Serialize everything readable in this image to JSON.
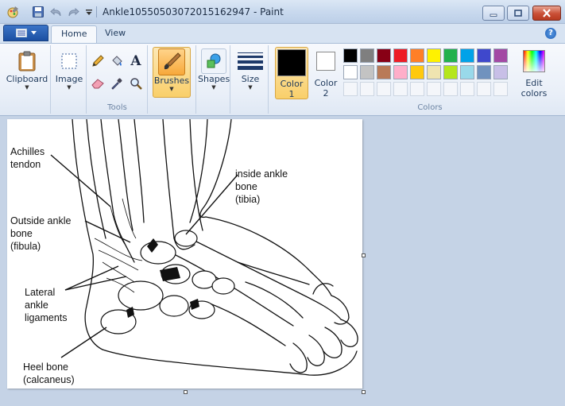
{
  "window": {
    "title": "Ankle10550503072015162947 - Paint"
  },
  "quick_access": {
    "icons": [
      "paint-app-icon",
      "save-icon",
      "undo-icon",
      "redo-icon",
      "customize-dropdown-icon"
    ]
  },
  "tabs": [
    {
      "label": "Home",
      "active": true
    },
    {
      "label": "View",
      "active": false
    }
  ],
  "ribbon": {
    "clipboard": {
      "label": "Clipboard"
    },
    "image": {
      "label": "Image"
    },
    "tools": {
      "group_label": "Tools"
    },
    "brushes": {
      "label": "Brushes"
    },
    "shapes": {
      "label": "Shapes"
    },
    "size": {
      "label": "Size"
    },
    "color1": {
      "label_line1": "Color",
      "label_line2": "1",
      "color": "#000000"
    },
    "color2": {
      "label_line1": "Color",
      "label_line2": "2",
      "color": "#ffffff"
    },
    "colors": {
      "group_label": "Colors",
      "row1": [
        "#000000",
        "#7f7f7f",
        "#880015",
        "#ed1c24",
        "#ff7f27",
        "#fff200",
        "#22b14c",
        "#00a2e8",
        "#3f48cc",
        "#a349a4"
      ],
      "row2": [
        "#ffffff",
        "#c3c3c3",
        "#b97a57",
        "#ffaec9",
        "#ffc90e",
        "#efe4b0",
        "#b5e61d",
        "#99d9ea",
        "#7092be",
        "#c8bfe7"
      ]
    },
    "edit_colors": {
      "label_line1": "Edit",
      "label_line2": "colors"
    }
  },
  "canvas": {
    "annotations": {
      "achilles": [
        "Achilles",
        "tendon"
      ],
      "inside_ankle": [
        "inside ankle",
        "bone",
        "(tibia)"
      ],
      "outside_ankle": [
        "Outside ankle",
        "bone",
        "(fibula)"
      ],
      "lateral": [
        "Lateral",
        "ankle",
        "ligaments"
      ],
      "heel": [
        "Heel bone",
        "(calcaneus)"
      ]
    }
  }
}
